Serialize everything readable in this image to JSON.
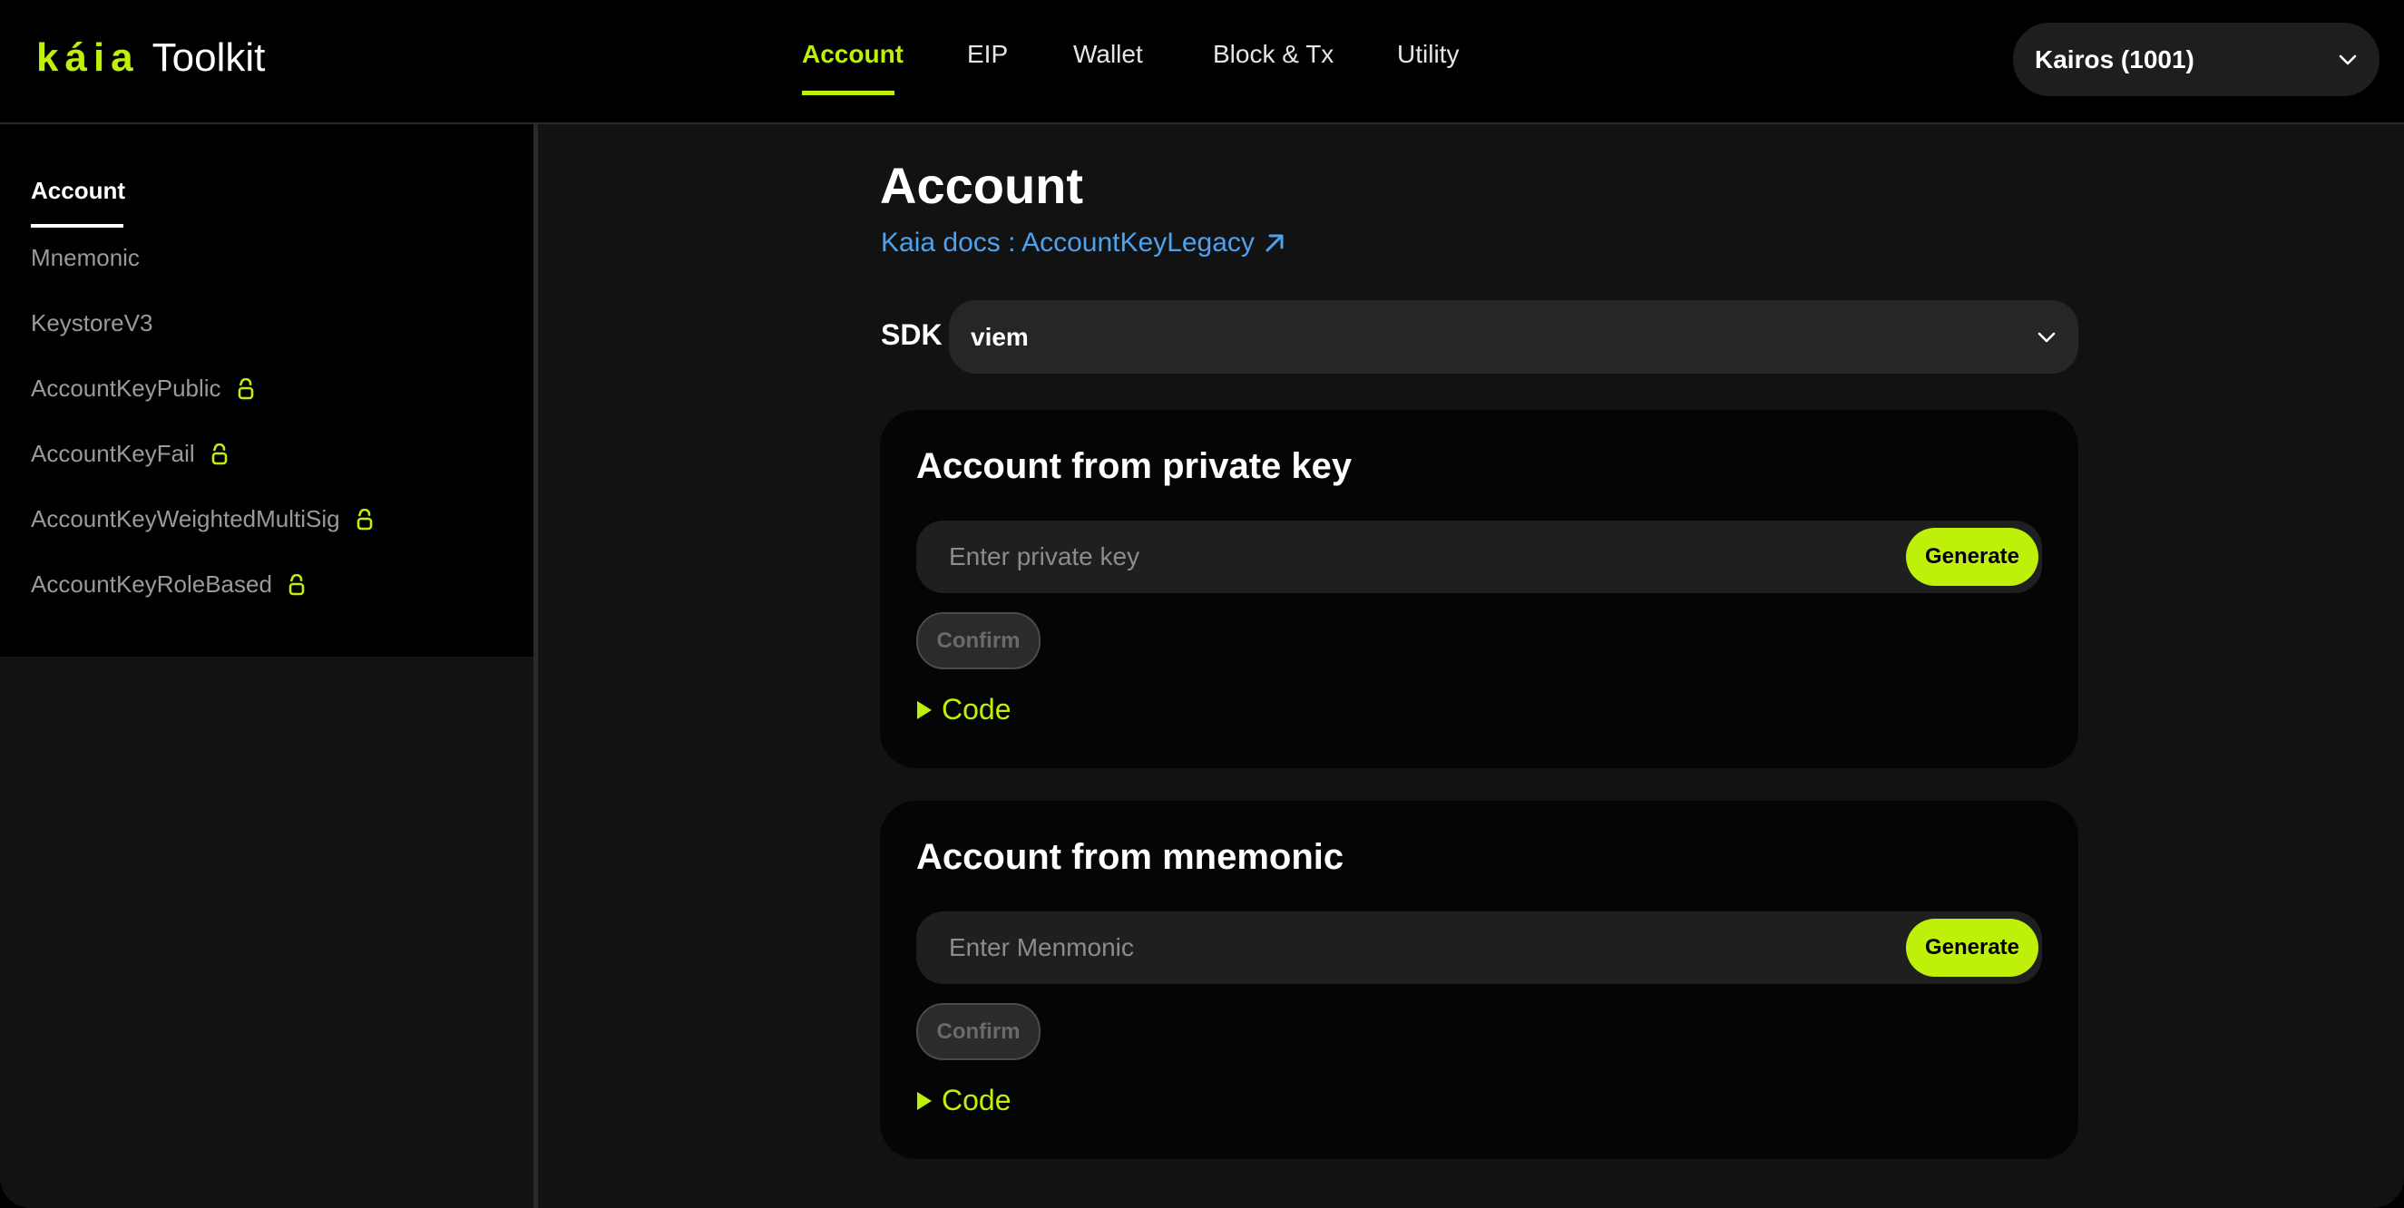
{
  "header": {
    "logo_mark": "káia",
    "logo_text": "Toolkit",
    "nav": [
      {
        "label": "Account",
        "active": true
      },
      {
        "label": "EIP",
        "active": false
      },
      {
        "label": "Wallet",
        "active": false
      },
      {
        "label": "Block & Tx",
        "active": false
      },
      {
        "label": "Utility",
        "active": false
      }
    ],
    "network": {
      "selected": "Kairos (1001)",
      "icon": "chevron-down-icon"
    }
  },
  "sidebar": {
    "items": [
      {
        "label": "Account",
        "active": true,
        "locked": false
      },
      {
        "label": "Mnemonic",
        "active": false,
        "locked": false
      },
      {
        "label": "KeystoreV3",
        "active": false,
        "locked": false
      },
      {
        "label": "AccountKeyPublic",
        "active": false,
        "locked": true
      },
      {
        "label": "AccountKeyFail",
        "active": false,
        "locked": true
      },
      {
        "label": "AccountKeyWeightedMultiSig",
        "active": false,
        "locked": true
      },
      {
        "label": "AccountKeyRoleBased",
        "active": false,
        "locked": true
      }
    ],
    "lock_icon": "lock-icon"
  },
  "main": {
    "title": "Account",
    "docs_link": "Kaia docs : AccountKeyLegacy",
    "docs_icon": "external-link-icon",
    "sdk": {
      "label": "SDK",
      "selected": "viem"
    },
    "cards": [
      {
        "title": "Account from private key",
        "placeholder": "Enter private key",
        "generate_label": "Generate",
        "confirm_label": "Confirm",
        "code_label": "Code"
      },
      {
        "title": "Account from mnemonic",
        "placeholder": "Enter Menmonic",
        "generate_label": "Generate",
        "confirm_label": "Confirm",
        "code_label": "Code"
      }
    ]
  },
  "colors": {
    "accent": "#bff009",
    "link": "#4da3f0",
    "background": "#121212",
    "card": "#050505"
  }
}
